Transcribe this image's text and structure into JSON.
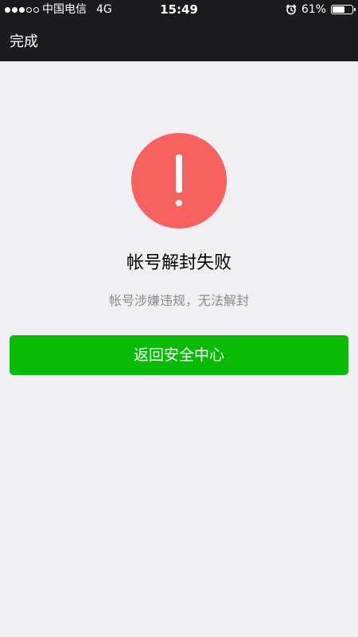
{
  "status_bar": {
    "carrier": "中国电信",
    "network": "4G",
    "time": "15:49",
    "battery_percent": "61%",
    "battery_level": 0.61,
    "signal": {
      "filled": 3,
      "total": 5
    },
    "alarm_icon": "alarm-clock-icon"
  },
  "nav": {
    "done_label": "完成"
  },
  "result": {
    "icon": "warning-exclamation-icon",
    "icon_color": "#f76260",
    "title": "帐号解封失败",
    "description": "帐号涉嫌违规，无法解封"
  },
  "actions": {
    "primary_label": "返回安全中心",
    "primary_color": "#09bb07"
  }
}
